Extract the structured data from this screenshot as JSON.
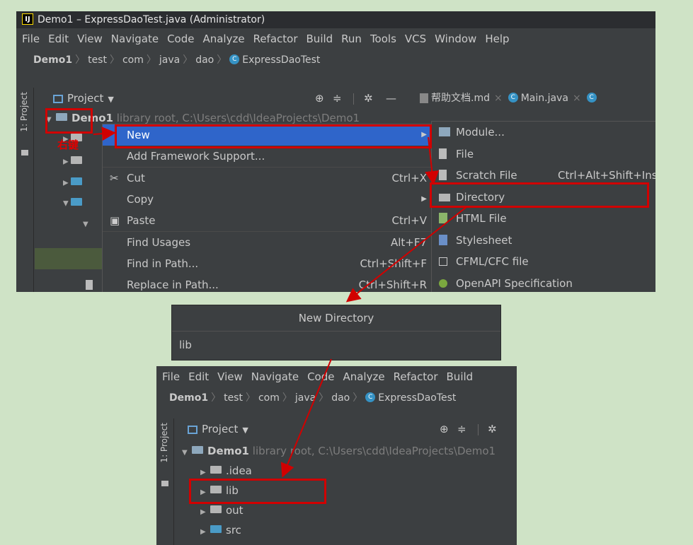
{
  "top": {
    "title": "Demo1 – ExpressDaoTest.java (Administrator)",
    "menu": [
      "File",
      "Edit",
      "View",
      "Navigate",
      "Code",
      "Analyze",
      "Refactor",
      "Build",
      "Run",
      "Tools",
      "VCS",
      "Window",
      "Help"
    ],
    "crumbs": [
      "Demo1",
      "test",
      "com",
      "java",
      "dao",
      "ExpressDaoTest"
    ],
    "side_tab": "1: Project",
    "panel_title": "Project",
    "tabs": [
      "帮助文档.md",
      "Main.java"
    ],
    "tree": {
      "root_label": "Demo1",
      "root_suffix": "library root, C:\\Users\\cdd\\IdeaProjects\\Demo1"
    },
    "annotation": "右键",
    "context_menu": [
      {
        "label": "New",
        "shortcut": ""
      },
      {
        "label": "Add Framework Support...",
        "shortcut": ""
      },
      {
        "label": "Cut",
        "shortcut": "Ctrl+X"
      },
      {
        "label": "Copy",
        "shortcut": ""
      },
      {
        "label": "Paste",
        "shortcut": "Ctrl+V"
      },
      {
        "label": "Find Usages",
        "shortcut": "Alt+F7"
      },
      {
        "label": "Find in Path...",
        "shortcut": "Ctrl+Shift+F"
      },
      {
        "label": "Replace in Path...",
        "shortcut": "Ctrl+Shift+R"
      }
    ],
    "submenu": [
      {
        "label": "Module...",
        "shortcut": ""
      },
      {
        "label": "File",
        "shortcut": ""
      },
      {
        "label": "Scratch File",
        "shortcut": "Ctrl+Alt+Shift+Ins"
      },
      {
        "label": "Directory",
        "shortcut": ""
      },
      {
        "label": "HTML File",
        "shortcut": ""
      },
      {
        "label": "Stylesheet",
        "shortcut": ""
      },
      {
        "label": "CFML/CFC file",
        "shortcut": ""
      },
      {
        "label": "OpenAPI Specification",
        "shortcut": ""
      }
    ]
  },
  "dialog": {
    "title": "New Directory",
    "value": "lib"
  },
  "bottom": {
    "menu": [
      "File",
      "Edit",
      "View",
      "Navigate",
      "Code",
      "Analyze",
      "Refactor",
      "Build"
    ],
    "crumbs": [
      "Demo1",
      "test",
      "com",
      "java",
      "dao",
      "ExpressDaoTest"
    ],
    "side_tab": "1: Project",
    "panel_title": "Project",
    "tree": {
      "root_label": "Demo1",
      "root_suffix": "library root, C:\\Users\\cdd\\IdeaProjects\\Demo1",
      "children": [
        ".idea",
        "lib",
        "out",
        "src"
      ]
    }
  },
  "colors": {
    "highlight": "#d10000",
    "selection": "#2f65ca",
    "background": "#cfe3c6",
    "ide_bg": "#3c3f41"
  }
}
